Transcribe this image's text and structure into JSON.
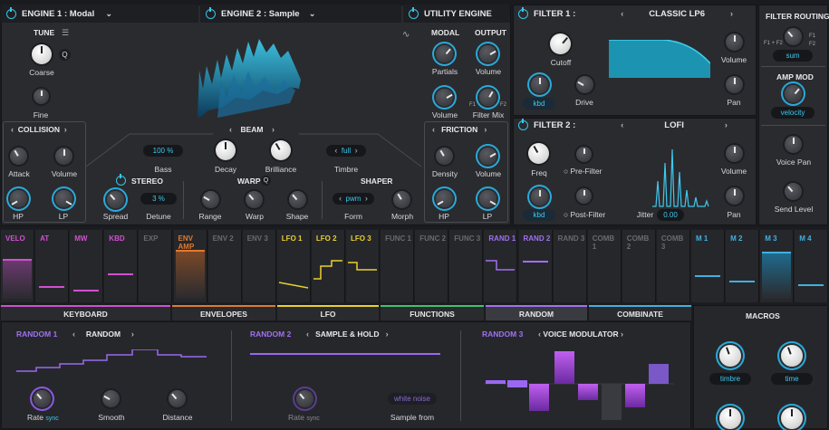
{
  "engine1": {
    "title": "ENGINE 1 : Modal",
    "tune": "TUNE",
    "coarse": "Coarse",
    "q": "Q",
    "fine": "Fine",
    "collision": "COLLISION",
    "attack": "Attack",
    "volume": "Volume",
    "hp": "HP",
    "lp": "LP"
  },
  "engine2": {
    "title": "ENGINE 2 : Sample",
    "beam": "BEAM",
    "bass_value": "100 %",
    "bass": "Bass",
    "decay": "Decay",
    "brilliance": "Brilliance",
    "timbre_value": "full",
    "timbre": "Timbre",
    "stereo": "STEREO",
    "spread": "Spread",
    "detune_value": "3 %",
    "detune": "Detune",
    "warp": "WARP",
    "warp_q": "Q",
    "range": "Range",
    "warp_knob": "Warp",
    "shape": "Shape",
    "shaper": "SHAPER",
    "form_value": "pwm",
    "form": "Form",
    "morph": "Morph"
  },
  "utility": {
    "title": "UTILITY ENGINE",
    "modal": "MODAL",
    "output": "OUTPUT",
    "partials": "Partials",
    "volume": "Volume",
    "volume2": "Volume",
    "filter_mix": "Filter Mix",
    "f1": "F1",
    "f2": "F2",
    "friction": "FRICTION",
    "density": "Density",
    "fvolume": "Volume",
    "hp": "HP",
    "lp": "LP"
  },
  "filter1": {
    "title": "FILTER 1 :",
    "type": "CLASSIC LP6",
    "cutoff": "Cutoff",
    "kbd": "kbd",
    "drive": "Drive",
    "volume": "Volume",
    "pan": "Pan"
  },
  "filter2": {
    "title": "FILTER 2 :",
    "type": "LOFI",
    "freq": "Freq",
    "prefilter": "Pre-Filter",
    "volume": "Volume",
    "kbd": "kbd",
    "postfilter": "Post-Filter",
    "jitter": "Jitter",
    "jitter_value": "0.00",
    "pan": "Pan"
  },
  "routing": {
    "title": "FILTER ROUTING",
    "f1": "F1",
    "f2": "F2",
    "f1f2": "F1 + F2",
    "mode": "sum",
    "amp_mod": "AMP MOD",
    "amp_mod_value": "velocity",
    "voice_pan": "Voice Pan",
    "send_level": "Send Level"
  },
  "mod_sources": [
    {
      "label": "VELO",
      "color": "#d050d0"
    },
    {
      "label": "AT",
      "color": "#d050d0"
    },
    {
      "label": "MW",
      "color": "#d050d0"
    },
    {
      "label": "KBD",
      "color": "#d050d0"
    },
    {
      "label": "EXP",
      "color": "#6a6a6e"
    },
    {
      "label": "ENV AMP",
      "color": "#e07a30"
    },
    {
      "label": "ENV 2",
      "color": "#6a6a6e"
    },
    {
      "label": "ENV 3",
      "color": "#6a6a6e"
    },
    {
      "label": "LFO 1",
      "color": "#e8d030"
    },
    {
      "label": "LFO 2",
      "color": "#e8d030"
    },
    {
      "label": "LFO 3",
      "color": "#e8d030"
    },
    {
      "label": "FUNC 1",
      "color": "#6a6a6e"
    },
    {
      "label": "FUNC 2",
      "color": "#6a6a6e"
    },
    {
      "label": "FUNC 3",
      "color": "#6a6a6e"
    },
    {
      "label": "RAND 1",
      "color": "#a070f0"
    },
    {
      "label": "RAND 2",
      "color": "#a070f0"
    },
    {
      "label": "RAND 3",
      "color": "#6a6a6e"
    },
    {
      "label": "COMB 1",
      "color": "#6a6a6e"
    },
    {
      "label": "COMB 2",
      "color": "#6a6a6e"
    },
    {
      "label": "COMB 3",
      "color": "#6a6a6e"
    },
    {
      "label": "M 1",
      "color": "#40b0e0"
    },
    {
      "label": "M 2",
      "color": "#40b0e0"
    },
    {
      "label": "M 3",
      "color": "#40b0e0"
    },
    {
      "label": "M 4",
      "color": "#40b0e0"
    }
  ],
  "tabs": [
    "KEYBOARD",
    "ENVELOPES",
    "LFO",
    "FUNCTIONS",
    "RANDOM",
    "COMBINATE"
  ],
  "random1": {
    "title": "RANDOM 1",
    "type": "RANDOM",
    "rate": "Rate",
    "sync": "sync",
    "smooth": "Smooth",
    "distance": "Distance"
  },
  "random2": {
    "title": "RANDOM 2",
    "type": "SAMPLE & HOLD",
    "rate": "Rate",
    "sync": "sync",
    "sample_value": "white noise",
    "sample_from": "Sample from"
  },
  "random3": {
    "title": "RANDOM 3",
    "type": "VOICE MODULATOR"
  },
  "macros": {
    "title": "MACROS",
    "m1": "timbre",
    "m2": "time"
  },
  "colors": {
    "accent": "#35c6ea",
    "purple": "#a070f0",
    "yellow": "#e8d030",
    "orange": "#e07a30",
    "magenta": "#d050d0"
  }
}
